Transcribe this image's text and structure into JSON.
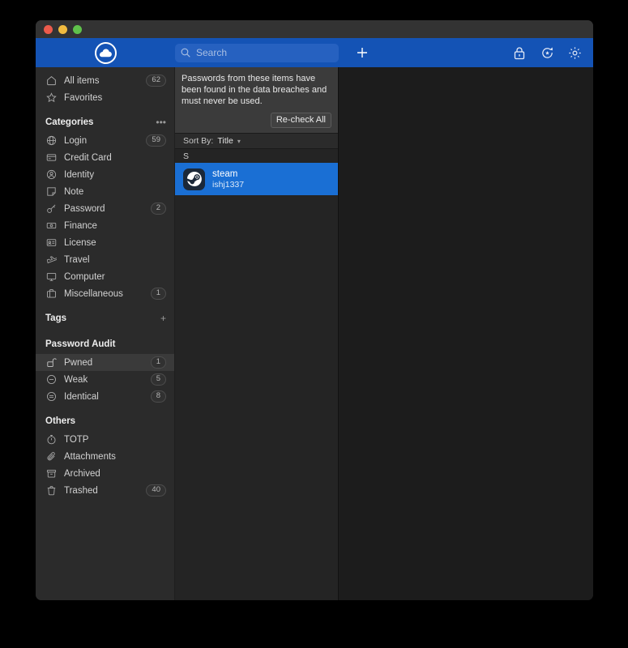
{
  "window": {
    "traffic_lights": [
      "close",
      "minimize",
      "zoom"
    ],
    "colors": {
      "accent": "#1453b5",
      "selection": "#1a6fd4",
      "sidebar_bg": "#2b2b2b",
      "list_bg": "#242424",
      "detail_bg": "#1c1c1c"
    }
  },
  "toolbar": {
    "logo_icon": "cloud-icon",
    "search": {
      "placeholder": "Search",
      "value": "",
      "icon": "search-icon"
    },
    "add_label": "+",
    "buttons": [
      {
        "name": "add-item-button",
        "icon": "plus-icon"
      },
      {
        "name": "lock-button",
        "icon": "lock-icon"
      },
      {
        "name": "sync-button",
        "icon": "sync-icon"
      },
      {
        "name": "settings-button",
        "icon": "gear-icon"
      }
    ]
  },
  "sidebar": {
    "top_items": [
      {
        "label": "All items",
        "count": "62",
        "icon": "home-icon"
      },
      {
        "label": "Favorites",
        "count": "",
        "icon": "star-icon"
      }
    ],
    "categories_header": {
      "title": "Categories",
      "action": "•••"
    },
    "categories": [
      {
        "label": "Login",
        "count": "59",
        "icon": "globe-icon"
      },
      {
        "label": "Credit Card",
        "count": "",
        "icon": "credit-card-icon"
      },
      {
        "label": "Identity",
        "count": "",
        "icon": "identity-icon"
      },
      {
        "label": "Note",
        "count": "",
        "icon": "note-icon"
      },
      {
        "label": "Password",
        "count": "2",
        "icon": "key-icon"
      },
      {
        "label": "Finance",
        "count": "",
        "icon": "finance-icon"
      },
      {
        "label": "License",
        "count": "",
        "icon": "license-icon"
      },
      {
        "label": "Travel",
        "count": "",
        "icon": "travel-icon"
      },
      {
        "label": "Computer",
        "count": "",
        "icon": "monitor-icon"
      },
      {
        "label": "Miscellaneous",
        "count": "1",
        "icon": "briefcase-icon"
      }
    ],
    "tags_header": {
      "title": "Tags",
      "action": "+"
    },
    "audit_header": {
      "title": "Password Audit"
    },
    "audit": [
      {
        "label": "Pwned",
        "count": "1",
        "icon": "unlocked-icon",
        "active": true
      },
      {
        "label": "Weak",
        "count": "5",
        "icon": "minus-circle-icon",
        "active": false
      },
      {
        "label": "Identical",
        "count": "8",
        "icon": "equals-circle-icon",
        "active": false
      }
    ],
    "others_header": {
      "title": "Others"
    },
    "others": [
      {
        "label": "TOTP",
        "count": "",
        "icon": "timer-icon"
      },
      {
        "label": "Attachments",
        "count": "",
        "icon": "paperclip-icon"
      },
      {
        "label": "Archived",
        "count": "",
        "icon": "archive-icon"
      },
      {
        "label": "Trashed",
        "count": "40",
        "icon": "trash-icon"
      }
    ]
  },
  "list_panel": {
    "notice": {
      "text": "Passwords from these items have been found in the data breaches and must never be used.",
      "button_label": "Re-check All"
    },
    "sort": {
      "label": "Sort By:",
      "value": "Title",
      "caret": "▾"
    },
    "group_label": "S",
    "items": [
      {
        "title": "steam",
        "subtitle": "ishj1337",
        "icon": "steam-icon",
        "selected": true
      }
    ]
  }
}
